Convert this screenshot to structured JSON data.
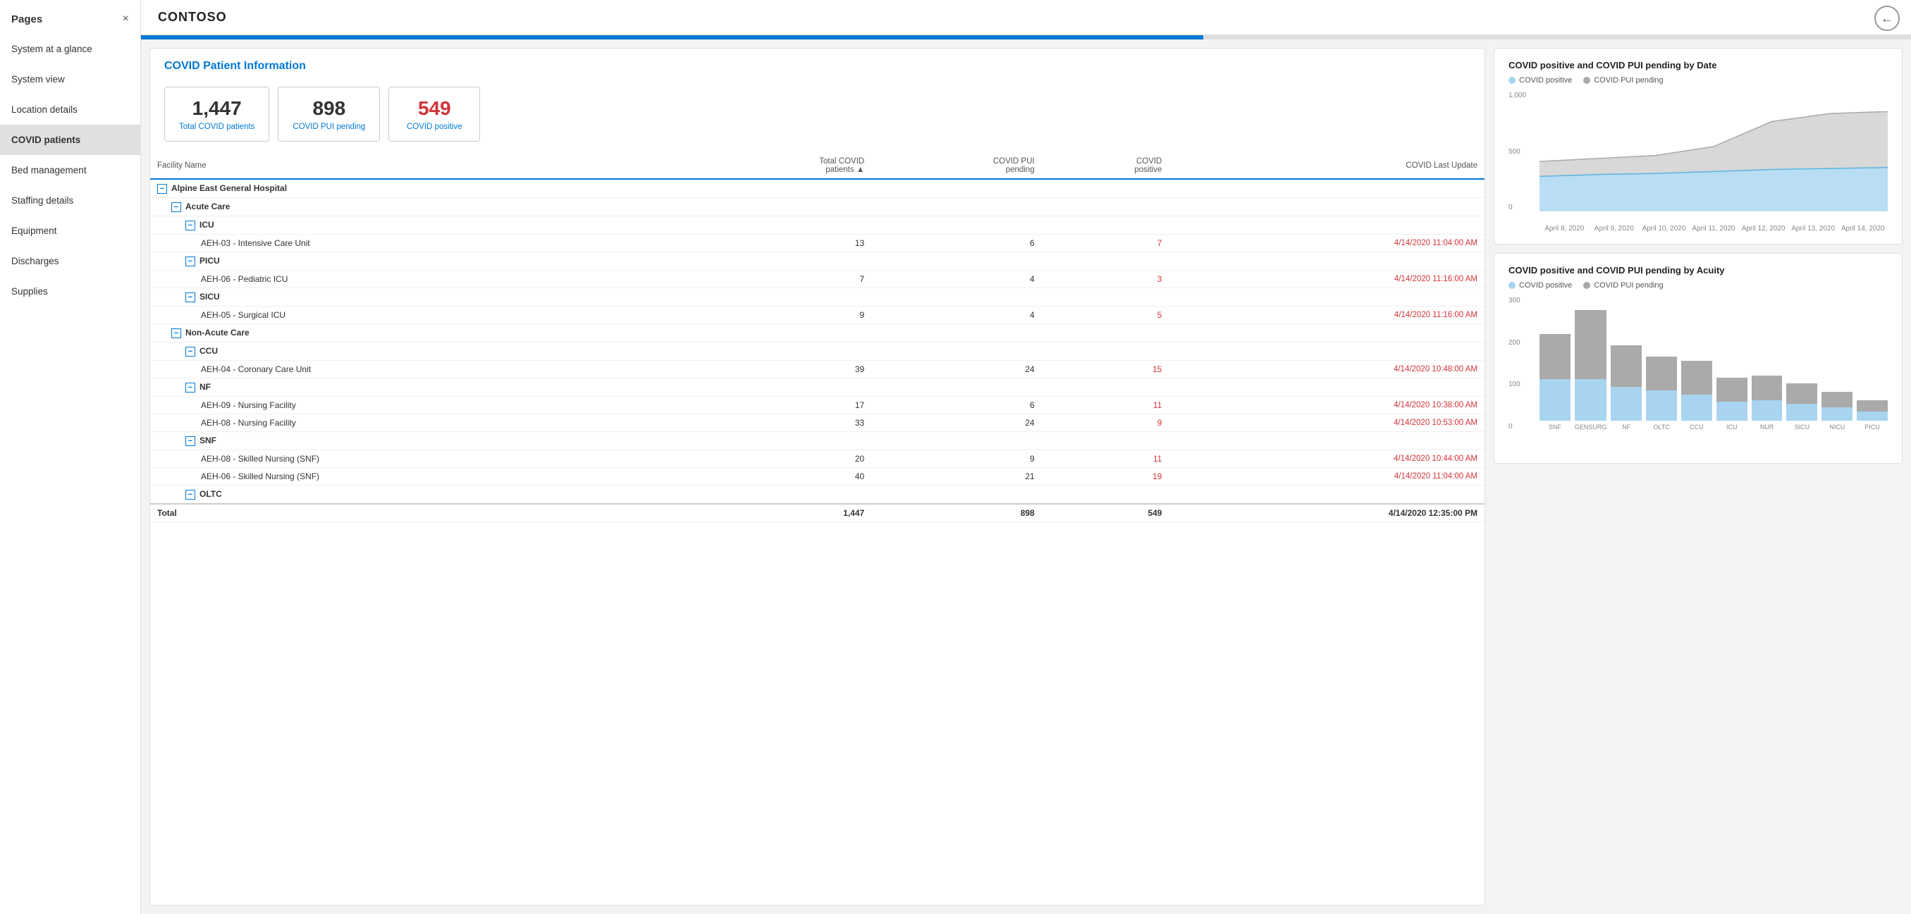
{
  "sidebar": {
    "header": "Pages",
    "close_label": "×",
    "items": [
      {
        "id": "system-at-glance",
        "label": "System at a glance",
        "active": false
      },
      {
        "id": "system-view",
        "label": "System view",
        "active": false
      },
      {
        "id": "location-details",
        "label": "Location details",
        "active": false
      },
      {
        "id": "covid-patients",
        "label": "COVID patients",
        "active": true
      },
      {
        "id": "bed-management",
        "label": "Bed management",
        "active": false
      },
      {
        "id": "staffing-details",
        "label": "Staffing details",
        "active": false
      },
      {
        "id": "equipment",
        "label": "Equipment",
        "active": false
      },
      {
        "id": "discharges",
        "label": "Discharges",
        "active": false
      },
      {
        "id": "supplies",
        "label": "Supplies",
        "active": false
      }
    ]
  },
  "header": {
    "title": "CONTOSO",
    "back_icon": "←"
  },
  "left_panel": {
    "title": "COVID Patient Information",
    "cards": [
      {
        "id": "total",
        "number": "1,447",
        "label": "Total COVID patients",
        "red": false
      },
      {
        "id": "pui",
        "number": "898",
        "label": "COVID PUI pending",
        "red": false
      },
      {
        "id": "positive",
        "number": "549",
        "label": "COVID positive",
        "red": true
      }
    ],
    "table": {
      "columns": [
        {
          "id": "facility",
          "label": "Facility Name"
        },
        {
          "id": "total_covid",
          "label": "Total COVID patients"
        },
        {
          "id": "pui",
          "label": "COVID PUI pending"
        },
        {
          "id": "positive",
          "label": "COVID positive"
        },
        {
          "id": "last_update",
          "label": "COVID Last Update"
        }
      ],
      "rows": [
        {
          "type": "group",
          "indent": 0,
          "label": "Alpine East General Hospital",
          "expand": true
        },
        {
          "type": "subgroup",
          "indent": 1,
          "label": "Acute Care",
          "expand": true
        },
        {
          "type": "subsubgroup",
          "indent": 2,
          "label": "ICU",
          "expand": true
        },
        {
          "type": "data",
          "facility": "AEH-03 - Intensive Care Unit",
          "total": "13",
          "pui": "6",
          "positive": "7",
          "last_update": "4/14/2020 11:04:00 AM"
        },
        {
          "type": "subsubgroup",
          "indent": 2,
          "label": "PICU",
          "expand": true
        },
        {
          "type": "data",
          "facility": "AEH-06 - Pediatric ICU",
          "total": "7",
          "pui": "4",
          "positive": "3",
          "last_update": "4/14/2020 11:16:00 AM"
        },
        {
          "type": "subsubgroup",
          "indent": 2,
          "label": "SICU",
          "expand": true
        },
        {
          "type": "data",
          "facility": "AEH-05 - Surgical ICU",
          "total": "9",
          "pui": "4",
          "positive": "5",
          "last_update": "4/14/2020 11:16:00 AM"
        },
        {
          "type": "subgroup",
          "indent": 1,
          "label": "Non-Acute Care",
          "expand": true
        },
        {
          "type": "subsubgroup",
          "indent": 2,
          "label": "CCU",
          "expand": true
        },
        {
          "type": "data",
          "facility": "AEH-04 - Coronary Care Unit",
          "total": "39",
          "pui": "24",
          "positive": "15",
          "last_update": "4/14/2020 10:48:00 AM"
        },
        {
          "type": "subsubgroup",
          "indent": 2,
          "label": "NF",
          "expand": true
        },
        {
          "type": "data",
          "facility": "AEH-09 - Nursing Facility",
          "total": "17",
          "pui": "6",
          "positive": "11",
          "last_update": "4/14/2020 10:38:00 AM"
        },
        {
          "type": "data",
          "facility": "AEH-08 - Nursing Facility",
          "total": "33",
          "pui": "24",
          "positive": "9",
          "last_update": "4/14/2020 10:53:00 AM"
        },
        {
          "type": "subsubgroup",
          "indent": 2,
          "label": "SNF",
          "expand": true
        },
        {
          "type": "data",
          "facility": "AEH-08 - Skilled Nursing (SNF)",
          "total": "20",
          "pui": "9",
          "positive": "11",
          "last_update": "4/14/2020 10:44:00 AM"
        },
        {
          "type": "data",
          "facility": "AEH-06 - Skilled Nursing (SNF)",
          "total": "40",
          "pui": "21",
          "positive": "19",
          "last_update": "4/14/2020 11:04:00 AM"
        },
        {
          "type": "subsubgroup",
          "indent": 2,
          "label": "OLTC",
          "expand": true
        }
      ],
      "total_row": {
        "label": "Total",
        "total": "1,447",
        "pui": "898",
        "positive": "549",
        "last_update": "4/14/2020 12:35:00 PM"
      }
    }
  },
  "right_panel": {
    "chart1": {
      "title": "COVID positive and COVID PUI pending by Date",
      "legend": [
        {
          "label": "COVID positive",
          "color": "blue"
        },
        {
          "label": "COVID PUI pending",
          "color": "gray"
        }
      ],
      "y_labels": [
        "0",
        "500",
        "1,000"
      ],
      "x_labels": [
        "April 8, 2020",
        "April 9, 2020",
        "April 10, 2020",
        "April 11, 2020",
        "April 12, 2020",
        "April 13, 2020",
        "April 14, 2020"
      ],
      "data_blue": [
        350,
        370,
        380,
        400,
        420,
        430,
        440
      ],
      "data_gray": [
        500,
        530,
        560,
        650,
        900,
        980,
        1000
      ]
    },
    "chart2": {
      "title": "COVID positive and COVID PUI pending by Acuity",
      "legend": [
        {
          "label": "COVID positive",
          "color": "blue"
        },
        {
          "label": "COVID PUI pending",
          "color": "gray"
        }
      ],
      "y_labels": [
        "0",
        "100",
        "200",
        "300"
      ],
      "bars": [
        {
          "label": "SNF",
          "blue": 110,
          "gray": 120
        },
        {
          "label": "GENSURG",
          "blue": 110,
          "gray": 185
        },
        {
          "label": "NF",
          "blue": 90,
          "gray": 110
        },
        {
          "label": "OLTC",
          "blue": 80,
          "gray": 90
        },
        {
          "label": "CCU",
          "blue": 70,
          "gray": 90
        },
        {
          "label": "ICU",
          "blue": 50,
          "gray": 65
        },
        {
          "label": "NUR",
          "blue": 55,
          "gray": 65
        },
        {
          "label": "SICU",
          "blue": 45,
          "gray": 55
        },
        {
          "label": "NICU",
          "blue": 35,
          "gray": 42
        },
        {
          "label": "PICU",
          "blue": 25,
          "gray": 30
        }
      ]
    }
  }
}
